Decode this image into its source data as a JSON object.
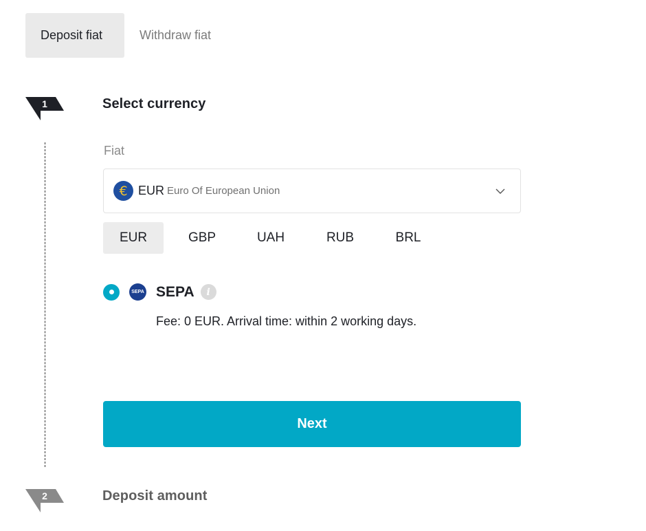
{
  "tabs": [
    {
      "label": "Deposit fiat",
      "active": true
    },
    {
      "label": "Withdraw fiat",
      "active": false
    }
  ],
  "steps": [
    {
      "number": "1",
      "title": "Select currency",
      "color": "#1e2026"
    },
    {
      "number": "2",
      "title": "Deposit amount",
      "color": "#8a8a8a"
    }
  ],
  "fiat_field": {
    "label": "Fiat",
    "selected_code": "EUR",
    "selected_name": "Euro Of European Union",
    "icon": "euro-icon"
  },
  "quick_currencies": [
    "EUR",
    "GBP",
    "UAH",
    "RUB",
    "BRL"
  ],
  "quick_selected": "EUR",
  "payment_method": {
    "name": "SEPA",
    "logo_text": "SEPA",
    "selected": true,
    "fee_text": "Fee: 0 EUR. Arrival time: within 2 working days."
  },
  "next_button": {
    "label": "Next"
  },
  "colors": {
    "accent": "#02a8c6",
    "step_active": "#1e2026",
    "step_inactive": "#8a8a8a"
  }
}
